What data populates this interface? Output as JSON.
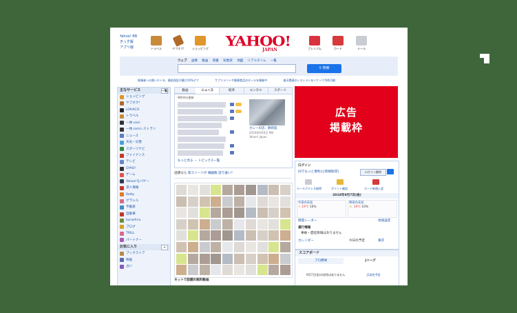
{
  "top_links": [
    "Yahoo! BB",
    "きっず版",
    "アプリ版"
  ],
  "services": [
    {
      "label": "トラベル",
      "icon": "suitcase-icon",
      "color": "#c8893a"
    },
    {
      "label": "ヤフオク!",
      "icon": "auction-hammer-icon",
      "color": "#b06a2a"
    },
    {
      "label": "ショッピング",
      "icon": "shopping-cart-icon",
      "color": "#e0962a"
    },
    {
      "label": "プレミアム",
      "icon": "gift-ribbon-icon",
      "color": "#d9333f"
    },
    {
      "label": "カード",
      "icon": "credit-card-icon",
      "color": "#d63a3a"
    },
    {
      "label": "メール",
      "icon": "mail-envelope-icon",
      "color": "#c9ccd2"
    }
  ],
  "logo": {
    "main": "YAHOO!",
    "sub": "JAPAN",
    "color": "#e00028"
  },
  "search": {
    "tabs": [
      "ウェブ",
      "画像",
      "動画",
      "辞書",
      "知恵袋",
      "地図",
      "リアルタイム",
      "一覧"
    ],
    "button_label": "検索",
    "placeholder": ""
  },
  "notices": [
    "既婚者への熱いキトを、最低保証が最大50%オフ",
    "サプリメントや健康食品のセールを開催中",
    "楽天関連のレストランをバナーで予約可能"
  ],
  "sidebar": {
    "heading": "主なサービス",
    "toggle": "一覧",
    "items": [
      {
        "label": "ショッピング",
        "color": "#e0962a"
      },
      {
        "label": "ヤフオク!",
        "color": "#b06a2a"
      },
      {
        "label": "LOHACO",
        "color": "#222222"
      },
      {
        "label": "トラベル",
        "color": "#c8893a"
      },
      {
        "label": "一休.com",
        "color": "#333333"
      },
      {
        "label": "一休.comレストラン",
        "color": "#333333"
      },
      {
        "label": "ニュース",
        "color": "#5b7fc2"
      },
      {
        "label": "天気・災害",
        "color": "#4aa0d8"
      },
      {
        "label": "スポーツナビ",
        "color": "#2e8a3e"
      },
      {
        "label": "ファイナンス",
        "color": "#c0392b"
      },
      {
        "label": "テレビ",
        "color": "#6a88c8"
      },
      {
        "label": "GYAO!",
        "color": "#333333"
      },
      {
        "label": "ゲーム",
        "color": "#e2534a"
      },
      {
        "label": "Yahoo!モバゲー",
        "color": "#2f3b52"
      },
      {
        "label": "求人情報",
        "color": "#c0392b"
      },
      {
        "label": "Retty",
        "color": "#e07a2e"
      },
      {
        "label": "グラシル",
        "color": "#d86a8a"
      },
      {
        "label": "不動産",
        "color": "#3f8fc8"
      },
      {
        "label": "自動車",
        "color": "#c0392b"
      },
      {
        "label": "kurashiru",
        "color": "#6b8d3a"
      },
      {
        "label": "ブログ",
        "color": "#d8a02e"
      },
      {
        "label": "TRILL",
        "color": "#d86a8a"
      },
      {
        "label": "パートナー",
        "color": "#a55ab8"
      }
    ],
    "fav_heading": "お気に入り",
    "fav_items": [
      {
        "label": "ブックストア",
        "color": "#b98a4a"
      },
      {
        "label": "映画",
        "color": "#5a6aa8"
      },
      {
        "label": "占い",
        "color": "#8a5ab8"
      }
    ]
  },
  "news": {
    "tabs": [
      "ニュース",
      "経済",
      "エンタメ",
      "スポーツ"
    ],
    "left_tab": "動画",
    "timestamp": "9時44分更新",
    "photo_caption": "カレーの店、静岡島",
    "photo_meta1": "2016年9月6日 9時",
    "photo_meta2": "Yahoo! Japan",
    "more": "もっと見る",
    "topics": "トピックス一覧"
  },
  "recent": {
    "prefix": "話題なら",
    "link1": "新スイーツが",
    "link2": "婚姻数 話で違い?"
  },
  "bottom_title": "ネットで話題の無料動画",
  "ad": {
    "line1": "広告",
    "line2": "掲載枠"
  },
  "login": {
    "heading": "ログイン",
    "caption": "IDでもっと便利に[新規取得]",
    "btn": "ログイン解除",
    "items": [
      "メールアドレス取得",
      "ポイント確認",
      "カード新規入会"
    ],
    "date": "2018年9月7日(金)",
    "weather_today": "今日の天気",
    "weather_tomorrow": "明日の天気",
    "today_temp": "19℃",
    "today_temp2": "10%",
    "tomorrow_temp": "19℃",
    "tomorrow_temp2": "10%",
    "region": "東京",
    "radar": "雨雲レーダー",
    "change": "地域設定",
    "traffic": "運行情報",
    "traffic_text": "事故・遅延情報はありません",
    "calendar": "カレンダー",
    "today": "今日の予定"
  },
  "scoreboard": {
    "heading": "スコアボード",
    "tab1": "プロ野球",
    "tab2": "Jリーグ",
    "msg": "9月7日(金)の試合はありません",
    "link": "J1試合予定"
  }
}
